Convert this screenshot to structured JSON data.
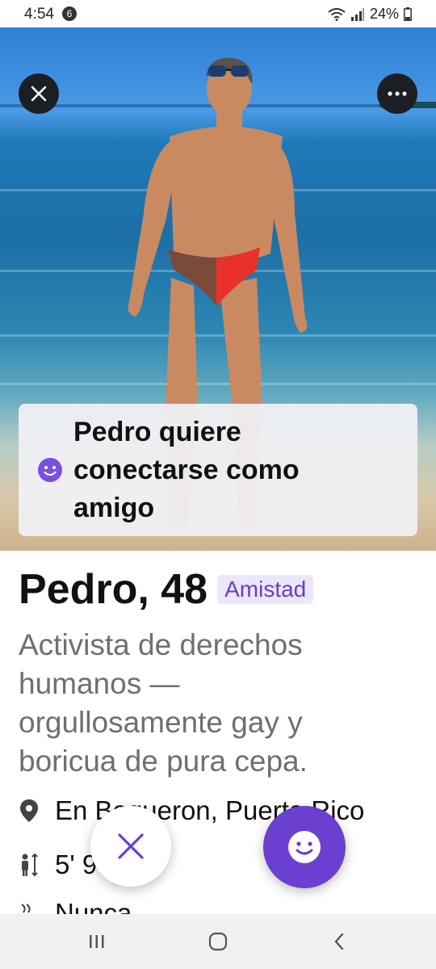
{
  "status_bar": {
    "time": "4:54",
    "notification_count": "6",
    "battery": "24%"
  },
  "match_card": {
    "connect_message": "Pedro quiere conectarse como amigo"
  },
  "profile": {
    "name_age": "Pedro, 48",
    "tag": "Amistad",
    "bio": "Activista de derechos humanos — orgullosamente gay y boricua de pura cepa.",
    "location": "En Boqueron, Puerto Rico",
    "height": "5' 9",
    "smoking": "Nunca"
  },
  "colors": {
    "accent": "#6b3fcf",
    "tag_bg": "#ece6fb"
  },
  "icons": {
    "close": "close-icon",
    "more": "more-icon",
    "smile": "smiley-icon",
    "location": "location-pin-icon",
    "height": "height-icon",
    "smoking": "smoking-icon"
  }
}
